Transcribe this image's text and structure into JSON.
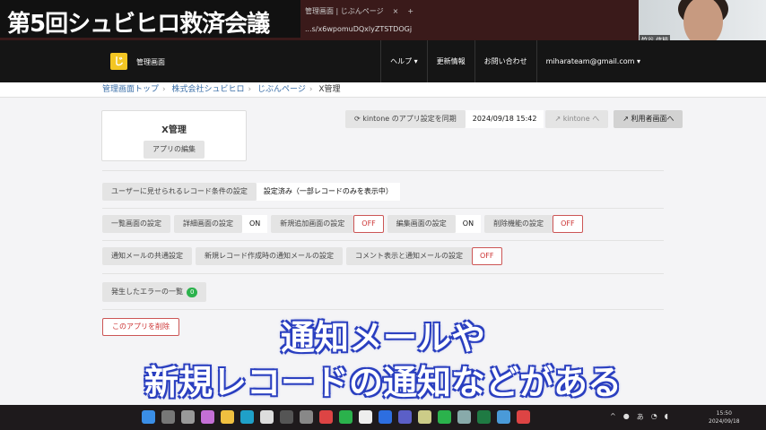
{
  "overlay": {
    "title": "第5回シュビヒロ救済会議",
    "subtitle_lines": [
      "通知メールや",
      "新規レコードの通知などがある"
    ]
  },
  "browser": {
    "tabs": [
      "管理画面 | じぶんページ",
      "×",
      "+"
    ],
    "url": "...s/x6wpomuDQxlyZTSTDOGj"
  },
  "webcam": {
    "name": "竹谷 信枝"
  },
  "nav": {
    "brand": "管理画面",
    "logo": "じ",
    "items": [
      "ヘルプ ▾",
      "更新情報",
      "お問い合わせ",
      "miharateam@gmail.com ▾"
    ]
  },
  "breadcrumb": [
    "管理画面トップ",
    "株式会社シュビヒロ",
    "じぶんページ",
    "X管理"
  ],
  "app": {
    "name": "X管理",
    "edit": "アプリの編集"
  },
  "sync": {
    "label": "⟳ kintone のアプリ設定を同期",
    "time": "2024/09/18 15:42",
    "kintone": "↗ kintone へ",
    "user": "↗ 利用者画面へ"
  },
  "record_cond": {
    "label": "ユーザーに見せられるレコード条件の設定",
    "value": "設定済み（一部レコードのみを表示中）"
  },
  "screens": [
    {
      "label": "一覧画面の設定"
    },
    {
      "label": "詳細画面の設定",
      "value": "ON",
      "state": "on"
    },
    {
      "label": "新規追加画面の設定",
      "value": "OFF",
      "state": "off"
    },
    {
      "label": "編集画面の設定",
      "value": "ON",
      "state": "on"
    },
    {
      "label": "削除機能の設定",
      "value": "OFF",
      "state": "off"
    }
  ],
  "mail": [
    {
      "label": "通知メールの共通設定"
    },
    {
      "label": "新規レコード作成時の通知メールの設定"
    },
    {
      "label": "コメント表示と通知メールの設定",
      "value": "OFF",
      "state": "off"
    }
  ],
  "errors": {
    "label": "発生したエラーの一覧",
    "count": "0"
  },
  "delete": "このアプリを削除",
  "taskbar": {
    "time": "15:50",
    "date": "2024/09/18",
    "ime": "あ"
  },
  "colors": {
    "accent_off": "#c33333",
    "badge": "#2bb24c",
    "link": "#3b6fa8",
    "nav": "#151515"
  }
}
